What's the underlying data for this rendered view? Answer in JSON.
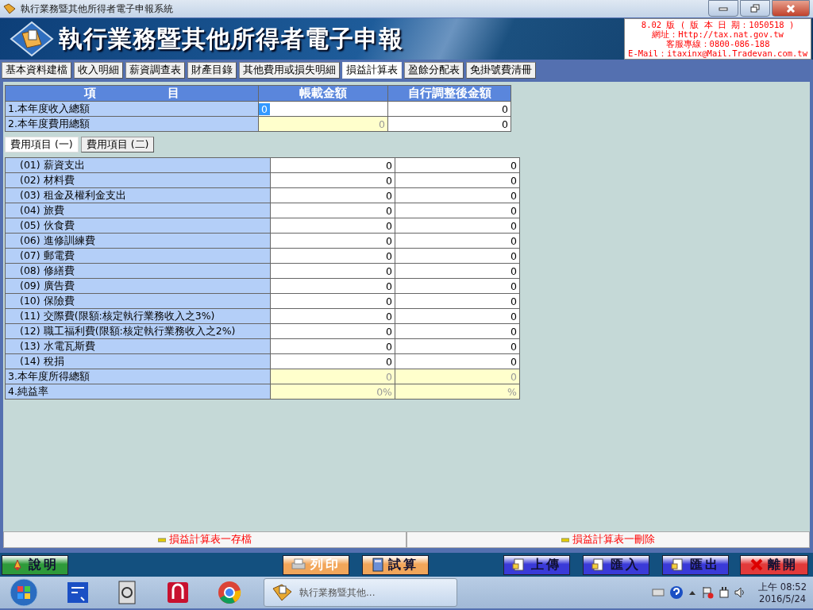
{
  "window": {
    "title": "執行業務暨其他所得者電子申報系統"
  },
  "banner": {
    "title": "執行業務暨其他所得者電子申報",
    "info": [
      "8.02 版 ( 版 本 日 期：1050518 )",
      "網址：Http://tax.nat.gov.tw",
      "客服專線：0800-086-188",
      "E-Mail：itaxinx@Mail.Tradevan.com.tw"
    ]
  },
  "tabs": [
    {
      "label": "基本資料建檔",
      "selected": false
    },
    {
      "label": "收入明細",
      "selected": false
    },
    {
      "label": "薪資調查表",
      "selected": false
    },
    {
      "label": "財產目錄",
      "selected": false
    },
    {
      "label": "其他費用或損失明細",
      "selected": false
    },
    {
      "label": "損益計算表",
      "selected": true
    },
    {
      "label": "盈餘分配表",
      "selected": false
    },
    {
      "label": "免掛號費清冊",
      "selected": false
    }
  ],
  "table": {
    "columns": [
      "項　　　　　　目",
      "帳載金額",
      "自行調整後金額"
    ],
    "summary_rows": [
      {
        "label": "1.本年度收入總額",
        "cells": [
          {
            "value": "0",
            "editable": true,
            "focused": true
          },
          {
            "value": "0",
            "editable": true,
            "focused": false
          }
        ]
      },
      {
        "label": "2.本年度費用總額",
        "cells": [
          {
            "value": "0",
            "editable": false,
            "focused": false
          },
          {
            "value": "0",
            "editable": true,
            "focused": false
          }
        ]
      }
    ],
    "sub_tabs": [
      {
        "label": "費用項目 (一)",
        "selected": true
      },
      {
        "label": "費用項目 (二)",
        "selected": false
      }
    ],
    "expense_rows": [
      {
        "label": "(01) 薪資支出",
        "cells": [
          {
            "value": "0",
            "editable": true,
            "focused": false
          },
          {
            "value": "0",
            "editable": true,
            "focused": false
          }
        ]
      },
      {
        "label": "(02) 材料費",
        "cells": [
          {
            "value": "0",
            "editable": true,
            "focused": false
          },
          {
            "value": "0",
            "editable": true,
            "focused": false
          }
        ]
      },
      {
        "label": "(03) 租金及權利金支出",
        "cells": [
          {
            "value": "0",
            "editable": true,
            "focused": false
          },
          {
            "value": "0",
            "editable": true,
            "focused": false
          }
        ]
      },
      {
        "label": "(04) 旅費",
        "cells": [
          {
            "value": "0",
            "editable": true,
            "focused": false
          },
          {
            "value": "0",
            "editable": true,
            "focused": false
          }
        ]
      },
      {
        "label": "(05) 伙食費",
        "cells": [
          {
            "value": "0",
            "editable": true,
            "focused": false
          },
          {
            "value": "0",
            "editable": true,
            "focused": false
          }
        ]
      },
      {
        "label": "(06) 進修訓練費",
        "cells": [
          {
            "value": "0",
            "editable": true,
            "focused": false
          },
          {
            "value": "0",
            "editable": true,
            "focused": false
          }
        ]
      },
      {
        "label": "(07) 郵電費",
        "cells": [
          {
            "value": "0",
            "editable": true,
            "focused": false
          },
          {
            "value": "0",
            "editable": true,
            "focused": false
          }
        ]
      },
      {
        "label": "(08) 修繕費",
        "cells": [
          {
            "value": "0",
            "editable": true,
            "focused": false
          },
          {
            "value": "0",
            "editable": true,
            "focused": false
          }
        ]
      },
      {
        "label": "(09) 廣告費",
        "cells": [
          {
            "value": "0",
            "editable": true,
            "focused": false
          },
          {
            "value": "0",
            "editable": true,
            "focused": false
          }
        ]
      },
      {
        "label": "(10) 保險費",
        "cells": [
          {
            "value": "0",
            "editable": true,
            "focused": false
          },
          {
            "value": "0",
            "editable": true,
            "focused": false
          }
        ]
      },
      {
        "label": "(11) 交際費(限額:核定執行業務收入之3%)",
        "cells": [
          {
            "value": "0",
            "editable": true,
            "focused": false
          },
          {
            "value": "0",
            "editable": true,
            "focused": false
          }
        ]
      },
      {
        "label": "(12) 職工福利費(限額:核定執行業務收入之2%)",
        "cells": [
          {
            "value": "0",
            "editable": true,
            "focused": false
          },
          {
            "value": "0",
            "editable": true,
            "focused": false
          }
        ]
      },
      {
        "label": "(13) 水電瓦斯費",
        "cells": [
          {
            "value": "0",
            "editable": true,
            "focused": false
          },
          {
            "value": "0",
            "editable": true,
            "focused": false
          }
        ]
      },
      {
        "label": "(14) 稅捐",
        "cells": [
          {
            "value": "0",
            "editable": true,
            "focused": false
          },
          {
            "value": "0",
            "editable": true,
            "focused": false
          }
        ]
      }
    ],
    "total_rows": [
      {
        "label": "3.本年度所得總額",
        "cells": [
          {
            "value": "0",
            "editable": false,
            "focused": false
          },
          {
            "value": "0",
            "editable": false,
            "focused": false
          }
        ]
      },
      {
        "label": "4.純益率",
        "cells": [
          {
            "value": "0%",
            "editable": false,
            "focused": false
          },
          {
            "value": "%",
            "editable": false,
            "focused": false
          }
        ]
      }
    ]
  },
  "actions": [
    "損益計算表一存檔",
    "損益計算表一刪除"
  ],
  "buttons": [
    {
      "label": "說明",
      "color": "#2e9a3a",
      "disabled": false
    },
    {
      "label": "列印",
      "color": "#f2a65a",
      "disabled": true
    },
    {
      "label": "試算",
      "color": "#f2a65a",
      "disabled": false
    },
    {
      "label": "上傳",
      "color": "#3a3ad8",
      "disabled": false
    },
    {
      "label": "匯入",
      "color": "#3a3ad8",
      "disabled": false
    },
    {
      "label": "匯出",
      "color": "#3a3ad8",
      "disabled": false
    },
    {
      "label": "離開",
      "color": "#e23a3a",
      "disabled": false
    }
  ],
  "taskbar": {
    "task": "執行業務暨其他...",
    "time": "上午 08:52",
    "date": "2016/5/24"
  }
}
